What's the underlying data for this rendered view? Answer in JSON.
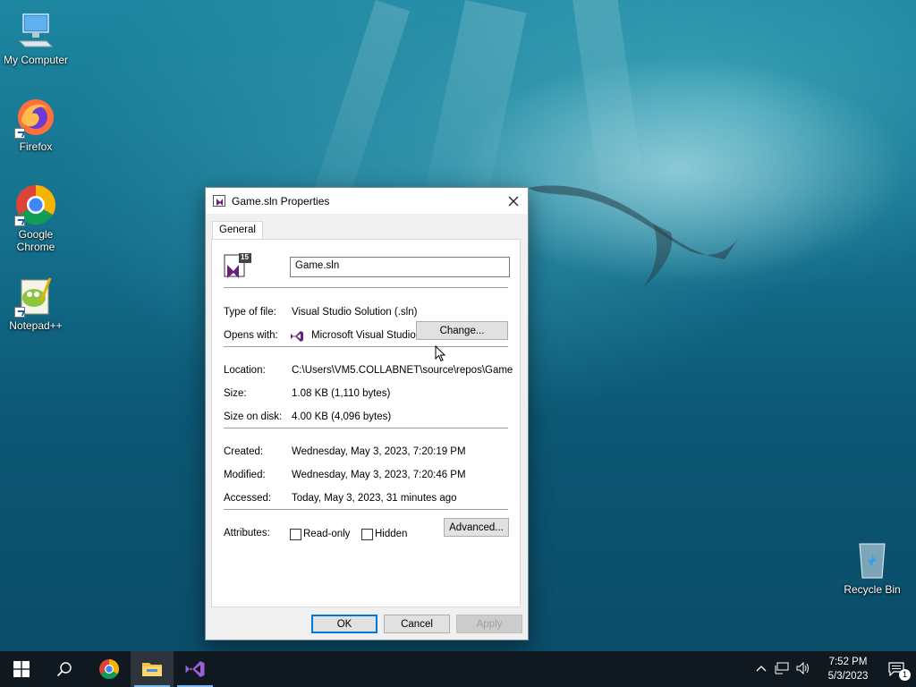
{
  "desktop": {
    "icons": [
      {
        "label": "My Computer"
      },
      {
        "label": "Firefox"
      },
      {
        "label": "Google Chrome"
      },
      {
        "label": "Notepad++"
      },
      {
        "label": "Recycle Bin"
      }
    ]
  },
  "dialog": {
    "title": "Game.sln Properties",
    "tab": "General",
    "file_name": "Game.sln",
    "file_icon_badge": "15",
    "type_label": "Type of file:",
    "type_value": "Visual Studio Solution (.sln)",
    "opens_label": "Opens with:",
    "opens_value": "Microsoft Visual Studio",
    "change_button": "Change...",
    "location_label": "Location:",
    "location_value": "C:\\Users\\VM5.COLLABNET\\source\\repos\\Game",
    "size_label": "Size:",
    "size_value": "1.08 KB (1,110 bytes)",
    "size_disk_label": "Size on disk:",
    "size_disk_value": "4.00 KB (4,096 bytes)",
    "created_label": "Created:",
    "created_value": "Wednesday, May 3, 2023, 7:20:19 PM",
    "modified_label": "Modified:",
    "modified_value": "Wednesday, May 3, 2023, 7:20:46 PM",
    "accessed_label": "Accessed:",
    "accessed_value": "Today, May 3, 2023, 31 minutes ago",
    "attributes_label": "Attributes:",
    "readonly_label": "Read-only",
    "readonly_checked": false,
    "hidden_label": "Hidden",
    "hidden_checked": false,
    "advanced_button": "Advanced...",
    "ok_button": "OK",
    "cancel_button": "Cancel",
    "apply_button": "Apply"
  },
  "taskbar": {
    "time": "7:52 PM",
    "date": "5/3/2023",
    "notification_count": "1"
  },
  "colors": {
    "vs_purple": "#68217a",
    "taskbar_bg": "#101820",
    "default_button_border": "#0078d7"
  }
}
